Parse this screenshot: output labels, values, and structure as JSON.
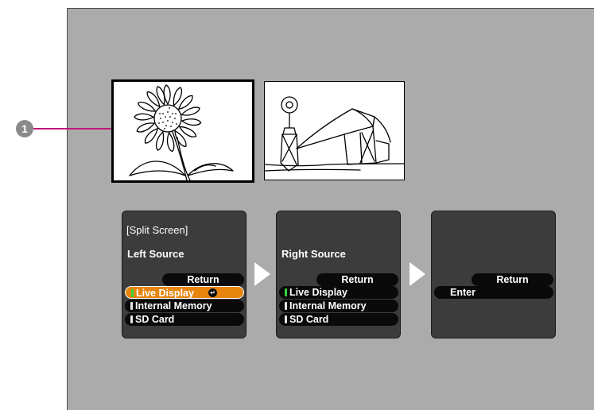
{
  "callout": {
    "number": "1"
  },
  "previews": {
    "left": {
      "icon": "sunflower-image"
    },
    "right": {
      "icon": "barn-windmill-image"
    }
  },
  "panels": [
    {
      "title": "[Split Screen]",
      "subtitle": "Left Source",
      "items": [
        {
          "label": "Return"
        },
        {
          "label": "Live Display",
          "selected": true,
          "indicator_color": "#35d43a"
        },
        {
          "label": "Internal Memory"
        },
        {
          "label": "SD Card"
        }
      ]
    },
    {
      "title": "",
      "subtitle": "Right Source",
      "items": [
        {
          "label": "Return"
        },
        {
          "label": "Live Display",
          "indicator_color": "#35d43a"
        },
        {
          "label": "Internal Memory"
        },
        {
          "label": "SD Card"
        }
      ]
    },
    {
      "title": "",
      "subtitle": "",
      "items": [
        {
          "label": "Return"
        },
        {
          "label": "Enter"
        }
      ]
    }
  ],
  "colors": {
    "screen_bg": "#ababab",
    "panel_bg": "#3c3c3c",
    "selected_item": "#e8850f",
    "callout_line": "#c0197a"
  }
}
